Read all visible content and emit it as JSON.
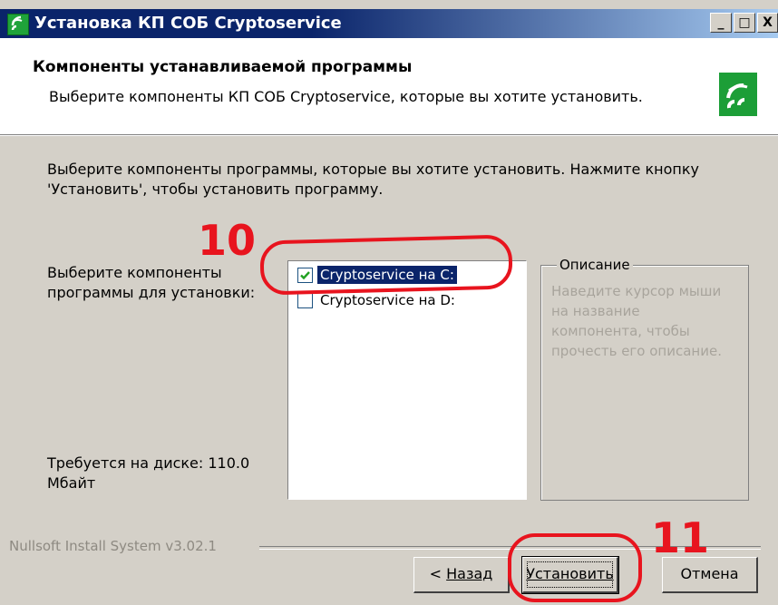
{
  "window": {
    "title": "Установка КП СОБ Cryptoservice",
    "controls": {
      "minimize": "_",
      "maximize": "□",
      "close": "X"
    }
  },
  "header": {
    "title": "Компоненты устанавливаемой программы",
    "subtitle": "Выберите компоненты КП СОБ Cryptoservice, которые вы хотите установить.",
    "logo_icon": "cryptoservice-logo-icon"
  },
  "body": {
    "intro": "Выберите компоненты программы, которые вы хотите установить. Нажмите кнопку 'Установить', чтобы установить программу.",
    "components_label": "Выберите компоненты программы для установки:",
    "components": [
      {
        "label": "Cryptoservice на C:",
        "checked": true,
        "selected": true
      },
      {
        "label": "Cryptoservice на D:",
        "checked": false,
        "selected": false
      }
    ],
    "description": {
      "legend": "Описание",
      "text": "Наведите курсор мыши на название компонента, чтобы прочесть его описание."
    },
    "space_required": "Требуется на диске: 110.0 Мбайт"
  },
  "footer": {
    "brand": "Nullsoft Install System v3.02.1",
    "back_prefix": "< ",
    "back_label": "Назад",
    "install_label": "Установить",
    "cancel_label": "Отмена"
  },
  "annotations": {
    "marker_10": "10",
    "marker_11": "11",
    "color": "#e8141e"
  },
  "colors": {
    "title_bar": "#0a246a",
    "window_face": "#d4d0c8",
    "selection": "#0a246a",
    "brand_green": "#1c9e37"
  }
}
